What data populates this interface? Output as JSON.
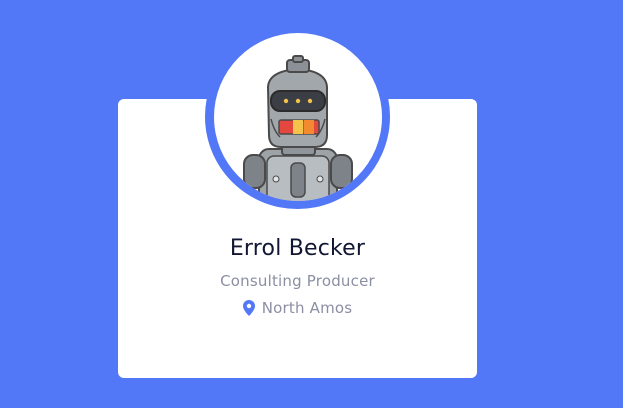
{
  "profile": {
    "name": "Errol Becker",
    "title": "Consulting Producer",
    "location": "North Amos"
  },
  "colors": {
    "background": "#5277F7",
    "card": "#FFFFFF",
    "name": "#111633",
    "secondary": "#8B8FA3",
    "pin": "#5277F7"
  },
  "icons": {
    "avatar": "robot-avatar",
    "location": "location-pin-icon"
  }
}
